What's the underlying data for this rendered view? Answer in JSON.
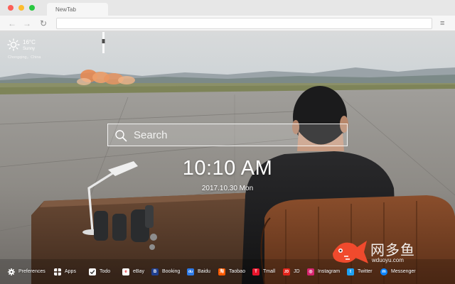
{
  "browser": {
    "tab_title": "NewTab",
    "nav": {
      "back_glyph": "←",
      "forward_glyph": "→",
      "reload_glyph": "↻",
      "menu_glyph": "≡"
    }
  },
  "weather": {
    "temperature": "16°C",
    "condition": "Sunny",
    "location": "Chongqing，China",
    "icon": "sun-icon"
  },
  "search": {
    "placeholder": "Search",
    "icon": "search-icon"
  },
  "clock": {
    "time": "10:10 AM",
    "date": "2017.10.30 Mon"
  },
  "watermark": {
    "text_cn": "网多鱼",
    "url": "wduoyu.com",
    "logo": "goldfish-logo"
  },
  "bottom_bar": {
    "preferences": "Preferences",
    "apps": "Apps",
    "todo": "Todo",
    "links": [
      {
        "label": "eBay",
        "icon": "ebay-icon",
        "color": "#ffffff",
        "glyph": "e"
      },
      {
        "label": "Booking",
        "icon": "booking-icon",
        "color": "#1f3f8f",
        "glyph": "B"
      },
      {
        "label": "Baidu",
        "icon": "baidu-icon",
        "color": "#2d7ae6",
        "glyph": "du"
      },
      {
        "label": "Taobao",
        "icon": "taobao-icon",
        "color": "#ff5a00",
        "glyph": "淘"
      },
      {
        "label": "Tmall",
        "icon": "tmall-icon",
        "color": "#e8142b",
        "glyph": "T"
      },
      {
        "label": "JD",
        "icon": "jd-icon",
        "color": "#e1251b",
        "glyph": "JD"
      },
      {
        "label": "Instagram",
        "icon": "instagram-icon",
        "color": "#d6246e",
        "glyph": "◎"
      },
      {
        "label": "Twitter",
        "icon": "twitter-icon",
        "color": "#1da1f2",
        "glyph": "t"
      },
      {
        "label": "Messenger",
        "icon": "messenger-icon",
        "color": "#0a84ff",
        "glyph": "m"
      }
    ]
  },
  "colors": {
    "chrome_bg": "#e7e7e7",
    "toolbar_bg": "#f6f6f6",
    "sky_top": "#d9dde0",
    "tarmac": "#8d8b88",
    "text_white": "#ffffff"
  }
}
